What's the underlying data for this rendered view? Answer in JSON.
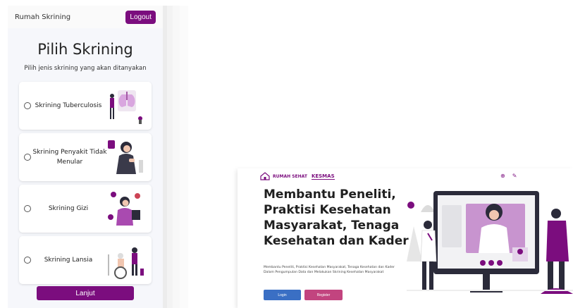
{
  "mobile": {
    "app_name": "Rumah Skrining",
    "logout_label": "Logout",
    "title": "Pilih Skrining",
    "subtitle": "Pilih jenis skrining yang akan ditanyakan",
    "options": [
      {
        "label": "Skrining Tuberculosis",
        "icon": "lungs-doctor-illustration"
      },
      {
        "label": "Skrining Penyakit Tidak Menular",
        "icon": "woman-sick-illustration"
      },
      {
        "label": "Skrining Gizi",
        "icon": "woman-food-illustration"
      },
      {
        "label": "Skrining Lansia",
        "icon": "elderly-illustration"
      }
    ],
    "next_label": "Lanjut"
  },
  "desktop": {
    "brand_text": "RUMAH SEHAT",
    "kesmas": "KESMAS",
    "hero_title": "Membantu Peneliti, Praktisi Kesehatan Masyarakat, Tenaga Kesehatan dan Kader",
    "hero_desc": "Membantu Peneliti, Praktisi Kesehatan Masyarakat, Tenaga Kesehatan dan Kader Dalam Pengumpulan Data dan Melakukan Skrining Kesehatan Masyarakat",
    "login_label": "Login",
    "register_label": "Register"
  },
  "colors": {
    "brand_purple": "#7b0d7e",
    "login_blue": "#3a6fc4",
    "register_pink": "#c2447f"
  }
}
